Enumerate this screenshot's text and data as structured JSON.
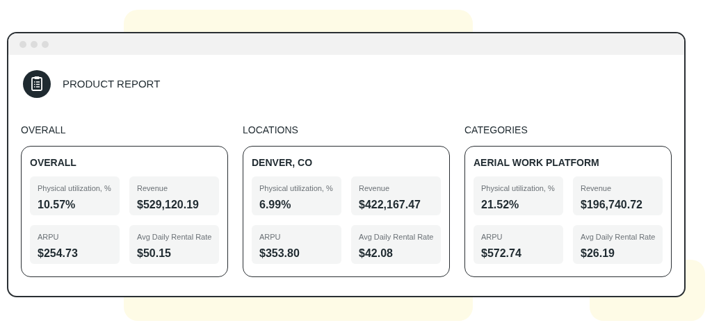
{
  "title": "PRODUCT REPORT",
  "sections": [
    {
      "heading": "OVERALL",
      "card_title": "OVERALL",
      "metrics": [
        {
          "label": "Physical utilization, %",
          "value": "10.57%"
        },
        {
          "label": "Revenue",
          "value": "$529,120.19"
        },
        {
          "label": "ARPU",
          "value": "$254.73"
        },
        {
          "label": "Avg Daily Rental Rate",
          "value": "$50.15"
        }
      ]
    },
    {
      "heading": "LOCATIONS",
      "card_title": "DENVER, CO",
      "metrics": [
        {
          "label": "Physical utilization, %",
          "value": "6.99%"
        },
        {
          "label": "Revenue",
          "value": "$422,167.47"
        },
        {
          "label": "ARPU",
          "value": "$353.80"
        },
        {
          "label": "Avg Daily Rental Rate",
          "value": "$42.08"
        }
      ]
    },
    {
      "heading": "CATEGORIES",
      "card_title": "AERIAL WORK PLATFORM",
      "metrics": [
        {
          "label": "Physical utilization, %",
          "value": "21.52%"
        },
        {
          "label": "Revenue",
          "value": "$196,740.72"
        },
        {
          "label": "ARPU",
          "value": "$572.74"
        },
        {
          "label": "Avg Daily Rental Rate",
          "value": "$26.19"
        }
      ]
    }
  ]
}
